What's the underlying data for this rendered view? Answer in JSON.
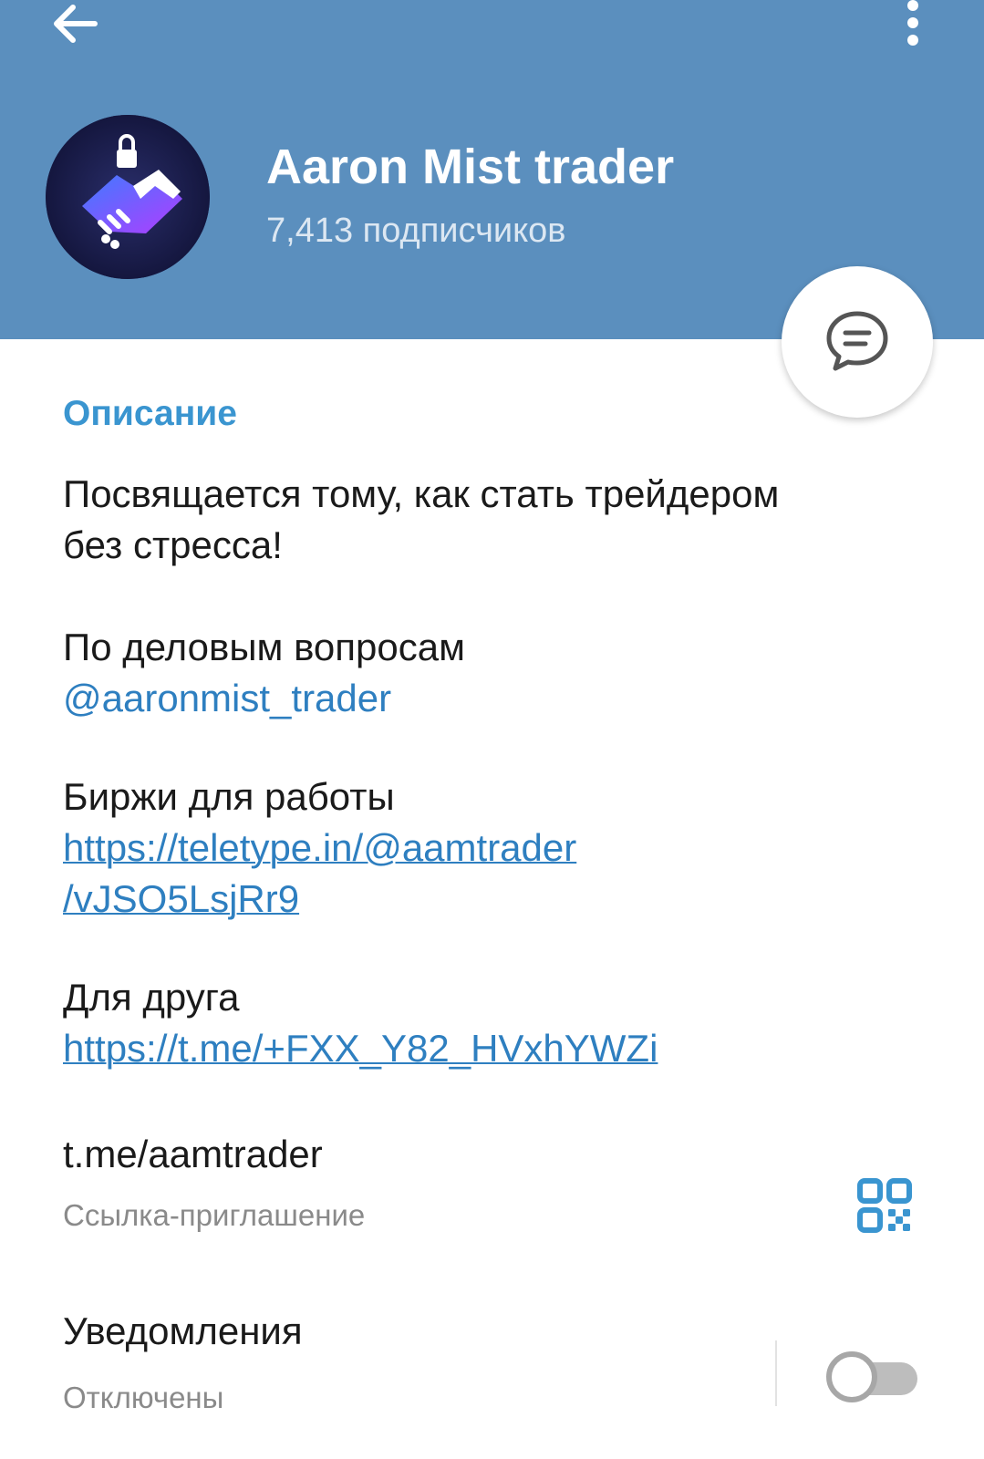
{
  "header": {
    "title": "Aaron Mist trader",
    "subtitle": "7,413 подписчиков",
    "back_icon": "arrow-left-icon",
    "more_icon": "more-vertical-icon",
    "header_color": "#5b8fbe"
  },
  "fab": {
    "icon": "chat-icon"
  },
  "description": {
    "section_title": "Описание",
    "line1": "Посвящается тому, как стать трейдером",
    "line2": "без стресса!",
    "business_label": "По деловым вопросам",
    "business_handle": "@aaronmist_trader",
    "exchanges_label": "Биржи для работы",
    "exchanges_link_line1": "https://teletype.in/@aamtrader",
    "exchanges_link_line2": "/vJSO5LsjRr9",
    "friend_label": "Для друга",
    "friend_link": "https://t.me/+FXX_Y82_HVxhYWZi"
  },
  "invite": {
    "link": "t.me/aamtrader",
    "caption": "Ссылка-приглашение",
    "qr_icon": "qr-code-icon"
  },
  "notifications": {
    "label": "Уведомления",
    "status": "Отключены",
    "enabled": false
  },
  "colors": {
    "accent": "#3a95d0",
    "link": "#2e7fc0"
  }
}
